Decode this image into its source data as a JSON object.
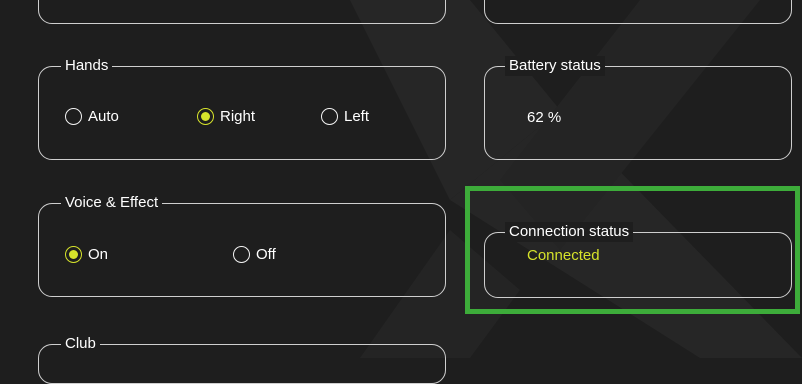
{
  "hands": {
    "title": "Hands",
    "options": [
      {
        "label": "Auto",
        "selected": false
      },
      {
        "label": "Right",
        "selected": true
      },
      {
        "label": "Left",
        "selected": false
      }
    ]
  },
  "voice_effect": {
    "title": "Voice & Effect",
    "options": [
      {
        "label": "On",
        "selected": true
      },
      {
        "label": "Off",
        "selected": false
      }
    ]
  },
  "battery": {
    "title": "Battery status",
    "value": "62 %"
  },
  "connection": {
    "title": "Connection status",
    "value": "Connected",
    "value_color": "#d6e32b"
  },
  "club": {
    "title": "Club"
  },
  "colors": {
    "background": "#1e1e1e",
    "accent": "#d6e32b",
    "highlight": "#3dac3a",
    "border": "#cfcfcf"
  }
}
